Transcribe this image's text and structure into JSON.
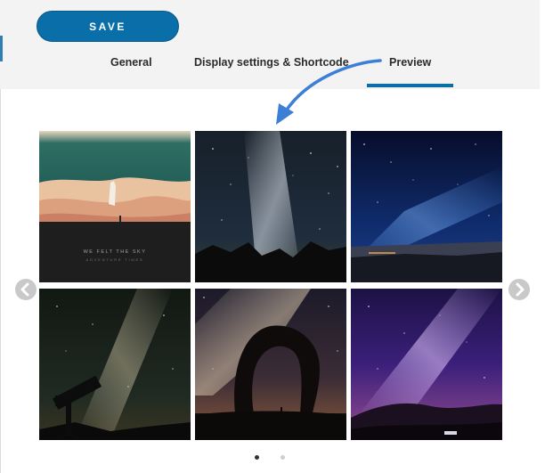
{
  "toolbar": {
    "save_label": "SAVE"
  },
  "tabs": [
    {
      "label": "General",
      "active": false
    },
    {
      "label": "Display settings & Shortcode",
      "active": false
    },
    {
      "label": "Preview",
      "active": true
    }
  ],
  "colors": {
    "accent": "#0a6ea8",
    "arrow": "#3d7fd6",
    "header_bg": "#f3f3f3"
  },
  "carousel": {
    "prev_icon": "chevron-left-icon",
    "next_icon": "chevron-right-icon",
    "page_count": 2,
    "active_page": 1
  },
  "gallery": {
    "tiles": [
      {
        "name": "gallery-tile-desert-sky",
        "text": "WE FELT THE SKY",
        "subtext": "ADVENTURE TIMES"
      },
      {
        "name": "gallery-tile-milky-way-mountains"
      },
      {
        "name": "gallery-tile-blue-starry-night"
      },
      {
        "name": "gallery-tile-telescope-milky-way"
      },
      {
        "name": "gallery-tile-delicate-arch"
      },
      {
        "name": "gallery-tile-purple-galaxy"
      }
    ]
  }
}
